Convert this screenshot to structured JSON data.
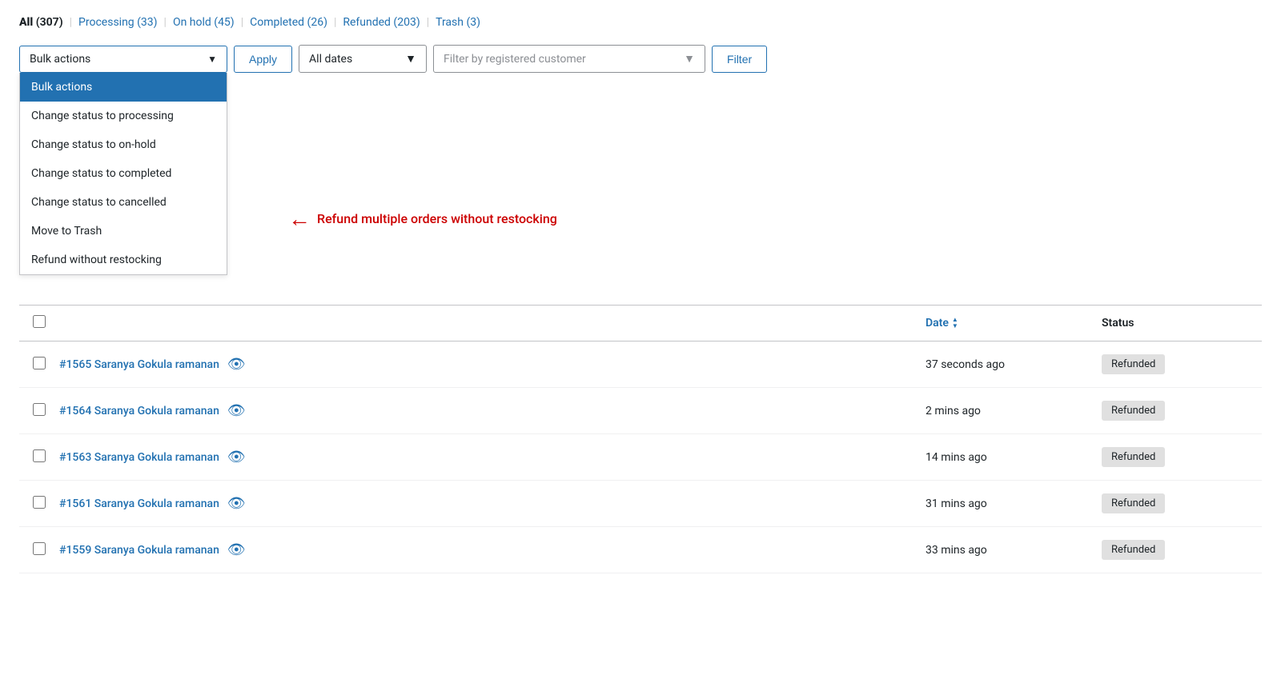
{
  "page": {
    "background_color": "#f0f0f1"
  },
  "status_filters": {
    "items": [
      {
        "label": "All",
        "count": "307",
        "active": true
      },
      {
        "label": "Processing",
        "count": "33",
        "active": false
      },
      {
        "label": "On hold",
        "count": "45",
        "active": false
      },
      {
        "label": "Completed",
        "count": "26",
        "active": false
      },
      {
        "label": "Refunded",
        "count": "203",
        "active": false
      },
      {
        "label": "Trash",
        "count": "3",
        "active": false
      }
    ]
  },
  "toolbar": {
    "bulk_actions_label": "Bulk actions",
    "apply_label": "Apply",
    "all_dates_label": "All dates",
    "customer_placeholder": "Filter by registered customer",
    "filter_label": "Filter",
    "chevron": "▼"
  },
  "dropdown": {
    "items": [
      {
        "label": "Bulk actions",
        "selected": true
      },
      {
        "label": "Change status to processing",
        "selected": false
      },
      {
        "label": "Change status to on-hold",
        "selected": false
      },
      {
        "label": "Change status to completed",
        "selected": false
      },
      {
        "label": "Change status to cancelled",
        "selected": false
      },
      {
        "label": "Move to Trash",
        "selected": false
      },
      {
        "label": "Refund without restocking",
        "selected": false
      }
    ]
  },
  "annotation": {
    "text": "Refund multiple orders without restocking"
  },
  "table": {
    "headers": {
      "date_label": "Date",
      "status_label": "Status"
    },
    "rows": [
      {
        "order": "#1565 Saranya Gokula ramanan",
        "date": "37 seconds ago",
        "status": "Refunded"
      },
      {
        "order": "#1564 Saranya Gokula ramanan",
        "date": "2 mins ago",
        "status": "Refunded"
      },
      {
        "order": "#1563 Saranya Gokula ramanan",
        "date": "14 mins ago",
        "status": "Refunded"
      },
      {
        "order": "#1561 Saranya Gokula ramanan",
        "date": "31 mins ago",
        "status": "Refunded"
      },
      {
        "order": "#1559 Saranya Gokula ramanan",
        "date": "33 mins ago",
        "status": "Refunded"
      }
    ]
  }
}
